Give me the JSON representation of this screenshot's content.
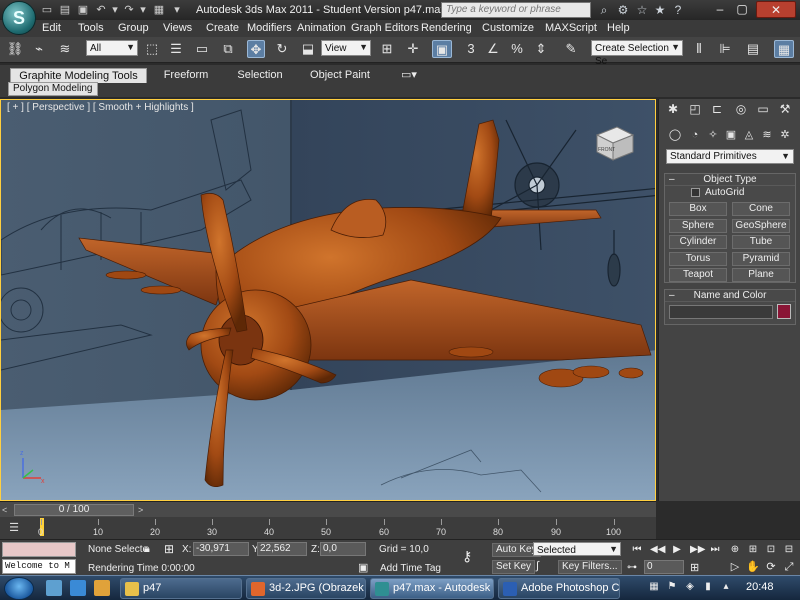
{
  "titlebar": {
    "title": "Autodesk 3ds Max  2011   -  Student Version    p47.max",
    "search_placeholder": "Type a keyword or phrase",
    "app_logo_glyph": "S"
  },
  "menu": [
    "Edit",
    "Tools",
    "Group",
    "Views",
    "Create",
    "Modifiers",
    "Animation",
    "Graph Editors",
    "Rendering",
    "Customize",
    "MAXScript",
    "Help"
  ],
  "toolbar": {
    "selection_filter": "All",
    "reference_coord": "View",
    "named_selection_placeholder": "Create Selection Se",
    "snap_value": "3"
  },
  "ribbon": {
    "tabs": [
      "Graphite Modeling Tools",
      "Freeform",
      "Selection",
      "Object Paint"
    ],
    "sub_tab": "Polygon Modeling"
  },
  "viewport": {
    "label": "[ + ] [ Perspective ] [ Smooth + Highlights ]",
    "viewcube_label": "FRONT"
  },
  "command_panel": {
    "category_dropdown": "Standard Primitives",
    "object_type_title": "Object Type",
    "autogrid_label": "AutoGrid",
    "object_buttons": [
      "Box",
      "Cone",
      "Sphere",
      "GeoSphere",
      "Cylinder",
      "Tube",
      "Torus",
      "Pyramid",
      "Teapot",
      "Plane"
    ],
    "name_color_title": "Name and Color",
    "object_color": "#8a1536"
  },
  "timeline": {
    "frame_display": "0 / 100",
    "ticks": [
      "0",
      "10",
      "20",
      "30",
      "40",
      "50",
      "60",
      "70",
      "80",
      "90",
      "100"
    ]
  },
  "status": {
    "maxscript_listener": "Welcome to M",
    "selection_text": "None Selecte",
    "x_label": "X:",
    "x_value": "-30,971",
    "y_label": "Y:",
    "y_value": "22,562",
    "z_label": "Z:",
    "z_value": "0,0",
    "grid": "Grid = 10,0",
    "rendering_time": "Rendering Time  0:00:00",
    "add_time_tag": "Add Time Tag",
    "auto_key": "Auto Key",
    "set_key": "Set Key",
    "key_mode": "Selected",
    "key_filters": "Key Filters...",
    "current_frame": "0"
  },
  "taskbar": {
    "tasks": [
      {
        "label": "p47",
        "icon_color": "#e8c04a"
      },
      {
        "label": "3d-2.JPG (Obrazek JP...",
        "icon_color": "#e0662c"
      },
      {
        "label": "p47.max - Autodesk ...",
        "icon_color": "#2f8f92"
      },
      {
        "label": "Adobe Photoshop C...",
        "icon_color": "#2b5fb3"
      }
    ],
    "clock": "20:48"
  },
  "colors": {
    "viewport_bg": "#3d4e60",
    "plane_body": "#a24a14",
    "active_viewport_border": "#ffcf3f"
  }
}
